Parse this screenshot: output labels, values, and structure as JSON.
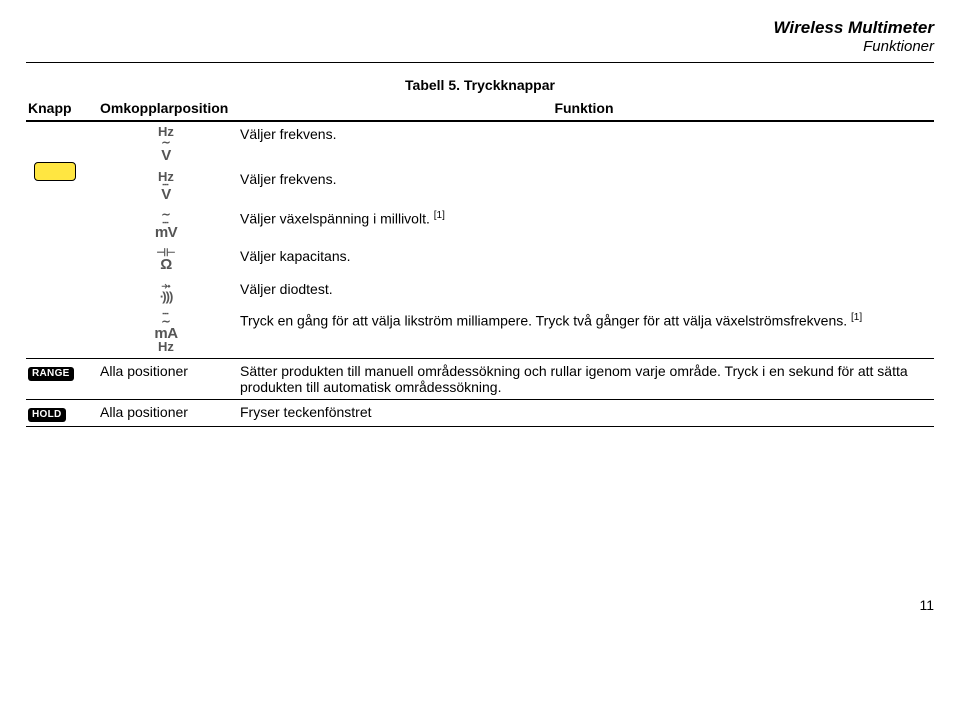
{
  "header": {
    "title": "Wireless Multimeter",
    "subtitle": "Funktioner"
  },
  "caption": "Tabell 5. Tryckknappar",
  "columns": {
    "c1": "Knapp",
    "c2": "Omkopplarposition",
    "c3": "Funktion"
  },
  "symbols": {
    "hz": "Hz",
    "v_upper": "V",
    "mv": "mV",
    "ohm": "Ω",
    "ma": "mA",
    "tilde": "∼",
    "dashes": "┄",
    "cap": "⊣⊢",
    "diode": "⤞",
    "cont": "∙)))"
  },
  "buttons": {
    "range": "RANGE",
    "hold": "HOLD"
  },
  "rows": {
    "r1_fn": "Väljer frekvens.",
    "r2_fn": "Väljer frekvens.",
    "r3_fn_a": "Väljer växelspänning i millivolt. ",
    "r3_sup": "[1]",
    "r4_fn": "Väljer kapacitans.",
    "r5_fn": "Väljer diodtest.",
    "r6_fn_a": "Tryck en gång för att välja likström milliampere. Tryck två gånger för att välja växelströmsfrekvens. ",
    "r6_sup": "[1]",
    "r7_pos": "Alla positioner",
    "r7_fn": "Sätter produkten till manuell områdessökning och rullar igenom varje område. Tryck i en sekund för att sätta produkten till automatisk områdessökning.",
    "r8_pos": "Alla positioner",
    "r8_fn": "Fryser teckenfönstret"
  },
  "page_number": "11"
}
